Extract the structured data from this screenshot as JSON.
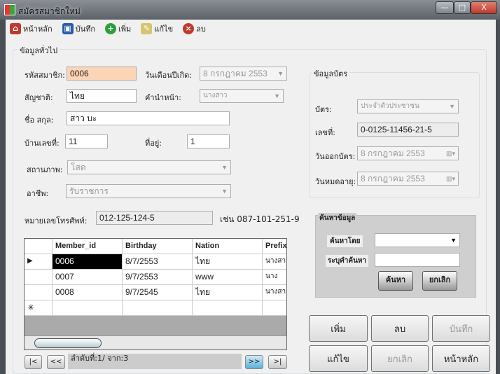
{
  "window": {
    "title": "สมัครสมาชิกใหม่",
    "min": "—",
    "max": "□",
    "close": "X"
  },
  "toolbar": {
    "home": "หน้าหลัก",
    "save": "บันทึก",
    "add": "เพิ่ม",
    "edit": "แก้ไข",
    "delete": "ลบ"
  },
  "general": {
    "title": "ข้อมูลทั่วไป",
    "member_id_label": "รหัสสมาชิก:",
    "member_id": "0006",
    "birthday_label": "วันเดือนปีเกิด:",
    "birthday": "8  กรกฎาคม   2553",
    "nation_label": "สัญชาติ:",
    "nation": "ไทย",
    "prefix_label": "คำนำหน้า:",
    "prefix": "นางสาว",
    "name_label": "ชื่อ สกุล:",
    "name": "สาว บะ",
    "house_no_label": "บ้านเลขที่:",
    "house_no": "11",
    "address_label": "ที่อยู่:",
    "address": "1",
    "status_label": "สถานภาพ:",
    "status": "โสด",
    "occupation_label": "อาชีพ:",
    "occupation": "รับราชการ",
    "phone_label": "หมายเลขโทรศัพท์:",
    "phone": "012-125-124-5",
    "phone_example": "เช่น 087-101-251-9"
  },
  "card": {
    "title": "ข้อมูลบัตร",
    "type_label": "บัตร:",
    "type": "ประจำตัวประชาชน",
    "number_label": "เลขที่:",
    "number": "0-0125-11456-21-5",
    "issue_label": "วันออกบัตร:",
    "issue": "8  กรกฎาคม   2553",
    "expire_label": "วันหมดอายุ:",
    "expire": "8  กรกฎาคม   2553"
  },
  "search": {
    "title": "ค้นหาข้อมูล",
    "by_label": "ค้นหาโดย",
    "by_value": "",
    "term_label": "ระบุคำค้นหา",
    "term_value": "",
    "search_btn": "ค้นหา",
    "cancel_btn": "ยกเลิก"
  },
  "grid": {
    "columns": [
      "Member_id",
      "Birthday",
      "Nation",
      "Prefix_"
    ],
    "rows": [
      [
        "0006",
        "8/7/2553",
        "ไทย",
        "นางสาว"
      ],
      [
        "0007",
        "9/7/2553",
        "www",
        "นาง"
      ],
      [
        "0008",
        "9/7/2545",
        "ไทย",
        "นางสาว"
      ]
    ],
    "current_marker": "▶",
    "new_marker": "✳"
  },
  "nav": {
    "first": "|<",
    "prev": "<<",
    "status": "ลำดับที่:1/ จาก:3",
    "next": ">>",
    "last": ">|"
  },
  "actions": {
    "add": "เพิ่ม",
    "delete": "ลบ",
    "save": "บันทึก",
    "edit": "แก้ไข",
    "cancel": "ยกเลิก",
    "home": "หน้าหลัก"
  }
}
